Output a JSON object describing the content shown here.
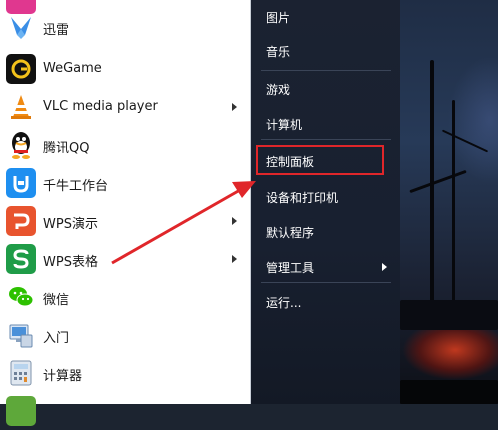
{
  "start_menu": {
    "programs": [
      {
        "label": "",
        "icon": "pink-app-icon",
        "has_submenu": false
      },
      {
        "label": "迅雷",
        "icon": "thunder-bird-icon",
        "has_submenu": false
      },
      {
        "label": "WeGame",
        "icon": "wegame-icon",
        "has_submenu": false
      },
      {
        "label": "VLC media player",
        "icon": "vlc-cone-icon",
        "has_submenu": true
      },
      {
        "label": "腾讯QQ",
        "icon": "qq-penguin-icon",
        "has_submenu": false
      },
      {
        "label": "千牛工作台",
        "icon": "qianniu-icon",
        "has_submenu": false
      },
      {
        "label": "WPS演示",
        "icon": "wps-presentation-icon",
        "has_submenu": true
      },
      {
        "label": "WPS表格",
        "icon": "wps-spreadsheet-icon",
        "has_submenu": true
      },
      {
        "label": "微信",
        "icon": "wechat-icon",
        "has_submenu": false
      },
      {
        "label": "入门",
        "icon": "getting-started-icon",
        "has_submenu": false
      },
      {
        "label": "计算器",
        "icon": "calculator-icon",
        "has_submenu": false
      }
    ],
    "places": [
      {
        "label": "图片",
        "has_submenu": false
      },
      {
        "label": "音乐",
        "has_submenu": false
      },
      {
        "label": "游戏",
        "has_submenu": false
      },
      {
        "label": "计算机",
        "has_submenu": false
      },
      {
        "label": "控制面板",
        "has_submenu": false,
        "highlighted": true
      },
      {
        "label": "设备和打印机",
        "has_submenu": false
      },
      {
        "label": "默认程序",
        "has_submenu": false
      },
      {
        "label": "管理工具",
        "has_submenu": true
      },
      {
        "label": "运行...",
        "has_submenu": false
      }
    ]
  },
  "annotation": {
    "highlight_color": "#e0262a",
    "target": "控制面板"
  }
}
